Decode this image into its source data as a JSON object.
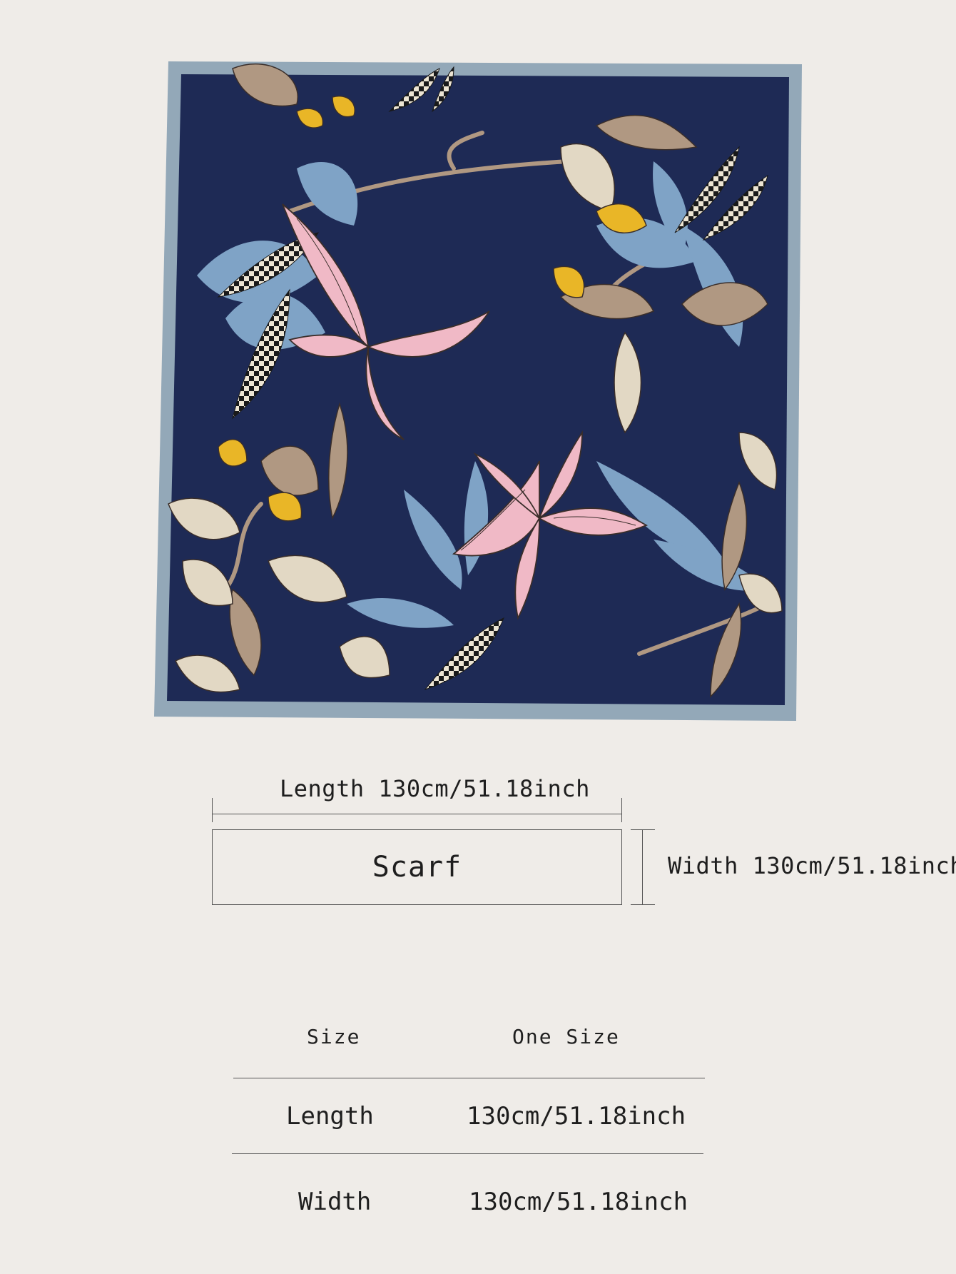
{
  "product_image": {
    "name": "Floral print square scarf",
    "colors": {
      "background": "#1e2a55",
      "border": "#93a8b8",
      "lily": "#f0b9c6",
      "blue_leaf": "#7fa3c6",
      "tan_leaf": "#b09882",
      "cream_leaf": "#e2d8c4",
      "yellow_flower": "#e9b627"
    }
  },
  "dimension_diagram": {
    "length_label": "Length 130cm/51.18inch",
    "width_label": "Width 130cm/51.18inch",
    "box_label": "Scarf"
  },
  "size_table": {
    "header": {
      "col1": "Size",
      "col2": "One Size"
    },
    "rows": [
      {
        "label": "Length",
        "value": "130cm/51.18inch"
      },
      {
        "label": "Width",
        "value": "130cm/51.18inch"
      }
    ]
  }
}
